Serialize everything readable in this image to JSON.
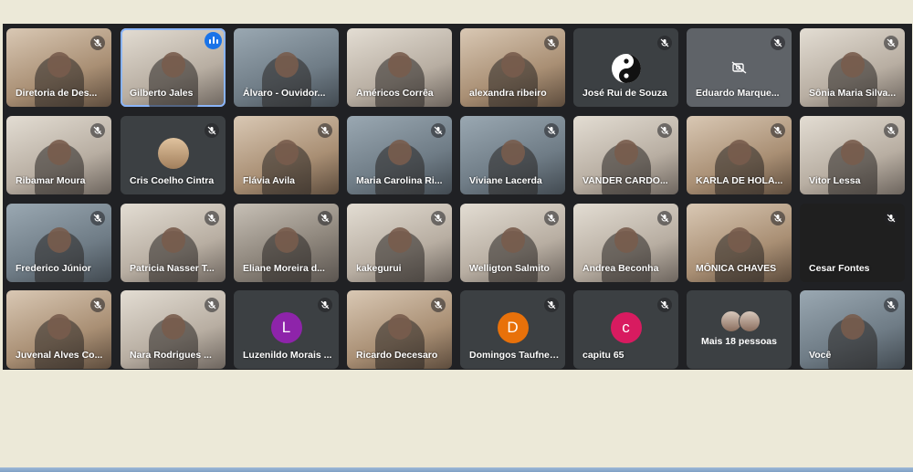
{
  "participants": [
    {
      "name": "Diretoria de Des...",
      "muted": true
    },
    {
      "name": "Gilberto Jales",
      "speaking": true
    },
    {
      "name": "Álvaro - Ouvidor...",
      "muted": false
    },
    {
      "name": "Américos Corrêa",
      "muted": false
    },
    {
      "name": "alexandra ribeiro",
      "muted": true
    },
    {
      "name": "José Rui de Souza",
      "muted": true,
      "avatar_icon": "yin-yang-icon"
    },
    {
      "name": "Eduardo Marque...",
      "muted": true,
      "camera_off": true
    },
    {
      "name": "Sônia Maria Silva...",
      "muted": true
    },
    {
      "name": "Ribamar Moura",
      "muted": true
    },
    {
      "name": "Cris Coelho Cintra",
      "muted": true
    },
    {
      "name": "Flávia Avila",
      "muted": true
    },
    {
      "name": "Maria Carolina Ri...",
      "muted": true
    },
    {
      "name": "Viviane Lacerda",
      "muted": true
    },
    {
      "name": "VANDER CARDO...",
      "muted": true
    },
    {
      "name": "KARLA DE HOLA...",
      "muted": true
    },
    {
      "name": "Vitor Lessa",
      "muted": true
    },
    {
      "name": "Frederico Júnior",
      "muted": true
    },
    {
      "name": "Patricia Nasser T...",
      "muted": true
    },
    {
      "name": "Eliane Moreira d...",
      "muted": true
    },
    {
      "name": "kakegurui",
      "muted": true
    },
    {
      "name": "Welligton Salmito",
      "muted": true
    },
    {
      "name": "Andrea Beconha",
      "muted": true
    },
    {
      "name": "MÔNICA CHAVES",
      "muted": true
    },
    {
      "name": "Cesar Fontes",
      "muted": true
    },
    {
      "name": "Juvenal Alves Co...",
      "muted": true
    },
    {
      "name": "Nara Rodrigues ...",
      "muted": true
    },
    {
      "name": "Luzenildo Morais ...",
      "muted": true,
      "initial": "L",
      "avatar_color": "#8e24aa"
    },
    {
      "name": "Ricardo Decesaro",
      "muted": true
    },
    {
      "name": "Domingos Taufner...",
      "muted": true,
      "initial": "D",
      "avatar_color": "#e8710a"
    },
    {
      "name": "capitu 65",
      "muted": true,
      "initial": "c",
      "avatar_color": "#d81b60"
    },
    {
      "name": "Mais 18 pessoas",
      "overflow": true
    },
    {
      "name": "Você",
      "muted": true
    }
  ],
  "colors": {
    "meeting_background": "#202124",
    "tile_background": "#3c4043",
    "speaking_accent": "#1a73e8",
    "page_background": "#ece9d8"
  }
}
